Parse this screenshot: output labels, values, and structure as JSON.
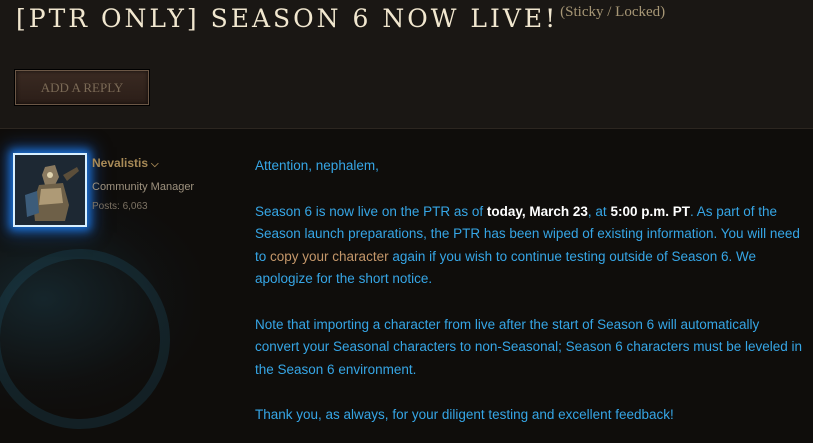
{
  "thread": {
    "title": "[PTR Only] Season 6 Now Live!",
    "status": "(Sticky / Locked)"
  },
  "actions": {
    "add_reply_label": "ADD A REPLY"
  },
  "post": {
    "author": {
      "name": "Nevalistis",
      "role": "Community Manager",
      "posts": "Posts: 6,063",
      "avatar_icon": "crusader-portrait-icon"
    },
    "body": {
      "greeting": "Attention, nephalem,",
      "p1_a": "Season 6 is now live on the PTR as of ",
      "p1_date": "today, March 23",
      "p1_b": ", at ",
      "p1_time": "5:00 p.m. PT",
      "p1_c": ". As part of the Season launch preparations, the PTR has been wiped of existing information. You will need to ",
      "p1_link": "copy your character",
      "p1_d": " again if you wish to continue testing outside of Season 6. We apologize for the short notice.",
      "p2": "Note that importing a character from live after the start of Season 6 will automatically convert your Seasonal characters to non-Seasonal; Season 6 characters must be leveled in the Season 6 environment.",
      "p3": "Thank you, as always, for your diligent testing and excellent feedback!"
    }
  },
  "colors": {
    "body_text": "#36a6e6",
    "emphasis": "#ffffff",
    "link": "#c4976a",
    "author_name": "#a88a57",
    "title": "#f1e7cf"
  }
}
